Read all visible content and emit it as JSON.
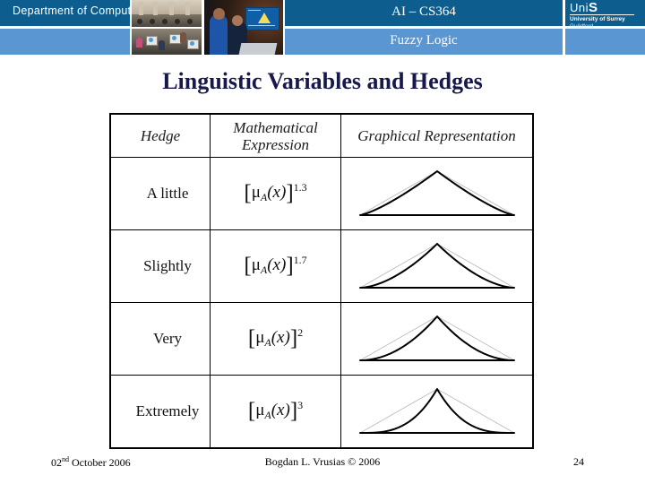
{
  "header": {
    "department": "Department of Computing",
    "course_title": "AI – CS364",
    "course_subtitle": "Fuzzy Logic",
    "logo": {
      "wordmark_prefix": "Uni",
      "wordmark_suffix": "S",
      "university": "University of Surrey",
      "town": "Guildford"
    },
    "colors": {
      "band_dark": "#0d5e8f",
      "band_light": "#5a96d2"
    },
    "photos": [
      {
        "name": "lecture-hall-photo"
      },
      {
        "name": "computer-lab-photo"
      },
      {
        "name": "students-at-laptop-photo"
      }
    ]
  },
  "slide": {
    "title": "Linguistic Variables and Hedges",
    "title_color": "#17184b"
  },
  "table": {
    "columns": [
      "Hedge",
      "Mathematical Expression",
      "Graphical Representation"
    ],
    "column_lines": [
      [
        "Hedge"
      ],
      [
        "Mathematical",
        "Expression"
      ],
      [
        "Graphical Representation"
      ]
    ],
    "rows": [
      {
        "hedge": "A little",
        "expression": "[μA(x)]1.3",
        "base": "μ",
        "subscript": "A",
        "argument": "(x)",
        "exponent": "1.3",
        "power": 1.3
      },
      {
        "hedge": "Slightly",
        "expression": "[μA(x)]1.7",
        "base": "μ",
        "subscript": "A",
        "argument": "(x)",
        "exponent": "1.7",
        "power": 1.7
      },
      {
        "hedge": "Very",
        "expression": "[μA(x)]2",
        "base": "μ",
        "subscript": "A",
        "argument": "(x)",
        "exponent": "2",
        "power": 2
      },
      {
        "hedge": "Extremely",
        "expression": "[μA(x)]3",
        "base": "μ",
        "subscript": "A",
        "argument": "(x)",
        "exponent": "3",
        "power": 3
      }
    ],
    "graph": {
      "reference_shape": "triangle",
      "reference_color": "#b9b9b9",
      "curve_color": "#000000",
      "baseline_color": "#000000"
    }
  },
  "footer": {
    "date_prefix": "02",
    "date_ordinal": "nd",
    "date_rest": " October 2006",
    "author": "Bogdan L. Vrusias © 2006",
    "page": "24"
  }
}
